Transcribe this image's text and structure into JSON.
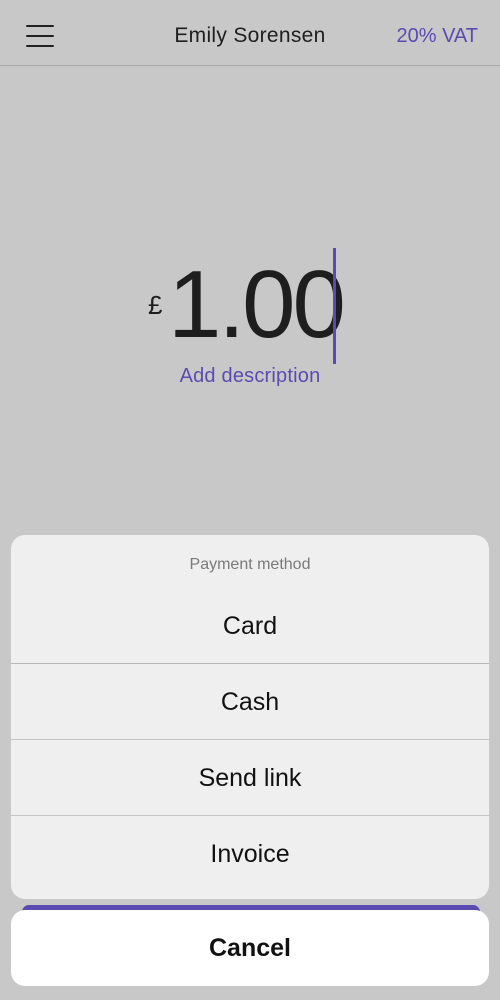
{
  "header": {
    "title": "Emily Sorensen",
    "vat_label": "20% VAT"
  },
  "amount": {
    "currency_symbol": "£",
    "value": "1.00"
  },
  "description": {
    "add_label": "Add description"
  },
  "payment_sheet": {
    "title": "Payment method",
    "options": [
      {
        "label": "Card"
      },
      {
        "label": "Cash"
      },
      {
        "label": "Send link"
      },
      {
        "label": "Invoice"
      }
    ],
    "cancel_label": "Cancel"
  },
  "colors": {
    "accent": "#5b4bb0",
    "background": "#c8c8c8",
    "sheet": "#efeff0"
  }
}
